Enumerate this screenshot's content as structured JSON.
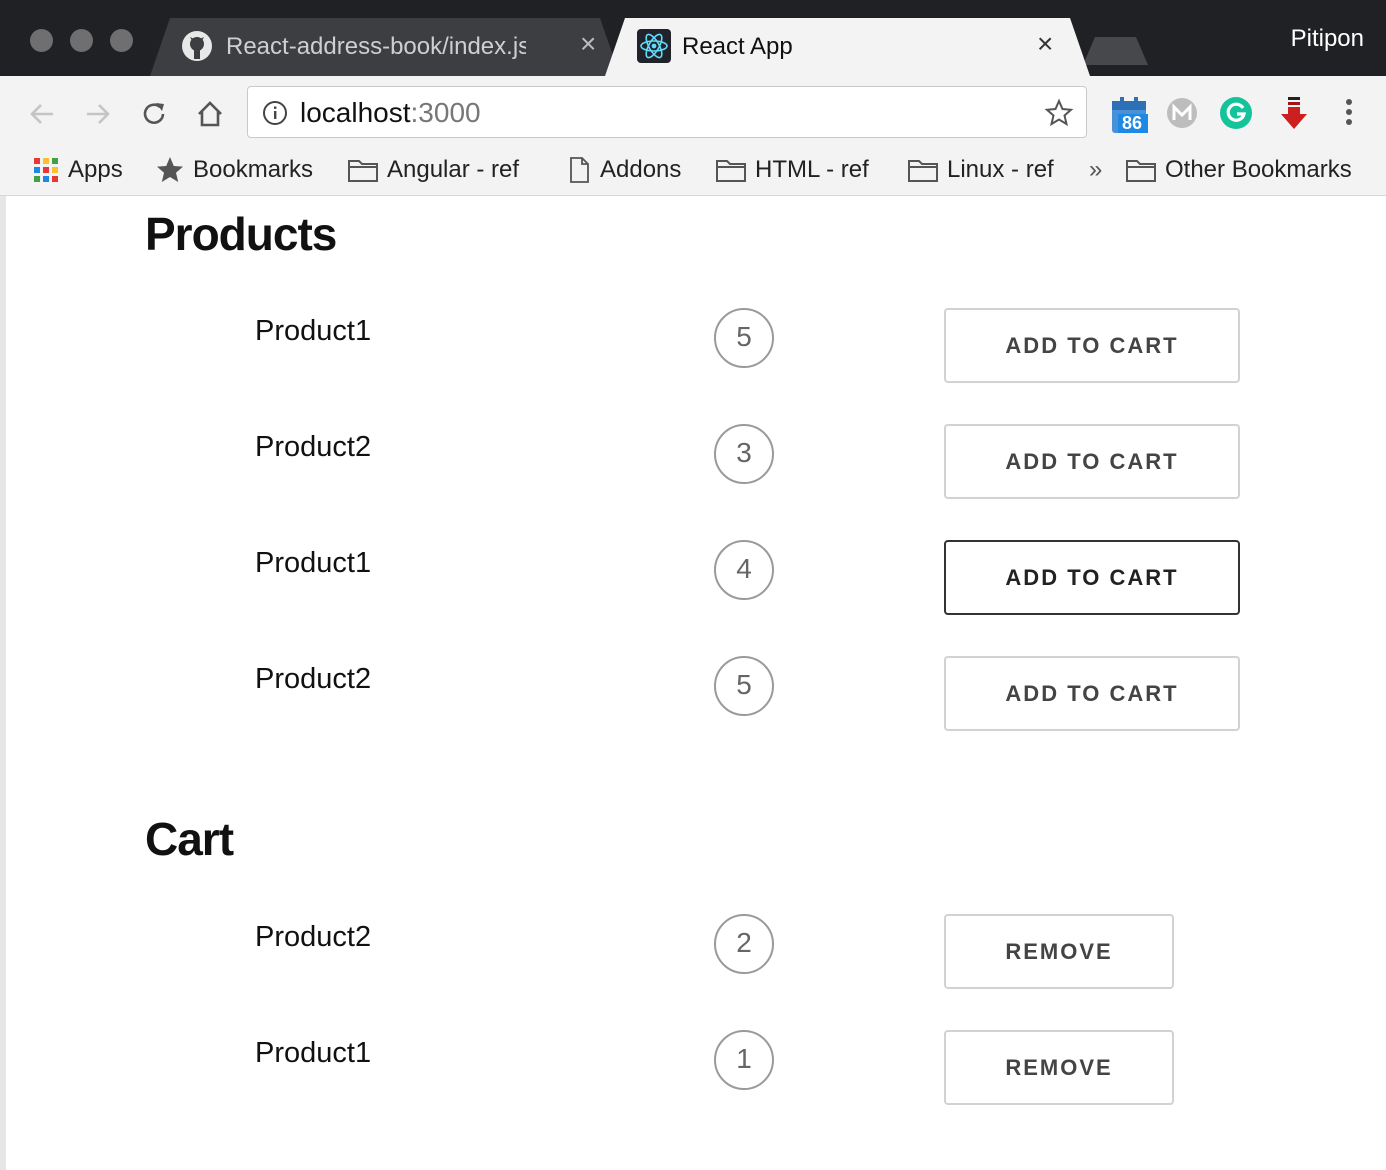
{
  "window": {
    "profile_name": "Pitipon"
  },
  "tabs": [
    {
      "title": "React-address-book/index.js a",
      "icon": "github-icon",
      "active": false
    },
    {
      "title": "React App",
      "icon": "react-icon",
      "active": true
    }
  ],
  "toolbar": {
    "url_host": "localhost",
    "url_port": ":3000",
    "extension_badge": "86"
  },
  "bookmarks": [
    {
      "label": "Apps",
      "icon": "apps-grid-icon"
    },
    {
      "label": "Bookmarks",
      "icon": "star-icon"
    },
    {
      "label": "Angular - ref",
      "icon": "folder-icon"
    },
    {
      "label": "Addons",
      "icon": "page-icon"
    },
    {
      "label": "HTML - ref",
      "icon": "folder-icon"
    },
    {
      "label": "Linux - ref",
      "icon": "folder-icon"
    },
    {
      "label": "»",
      "icon": "chevron-double-icon"
    },
    {
      "label": "Other Bookmarks",
      "icon": "folder-icon"
    }
  ],
  "products": {
    "heading": "Products",
    "button_label": "ADD TO CART",
    "items": [
      {
        "name": "Product1",
        "quantity": "5"
      },
      {
        "name": "Product2",
        "quantity": "3"
      },
      {
        "name": "Product1",
        "quantity": "4"
      },
      {
        "name": "Product2",
        "quantity": "5"
      }
    ]
  },
  "cart": {
    "heading": "Cart",
    "button_label": "REMOVE",
    "items": [
      {
        "name": "Product2",
        "quantity": "2"
      },
      {
        "name": "Product1",
        "quantity": "1"
      }
    ]
  }
}
